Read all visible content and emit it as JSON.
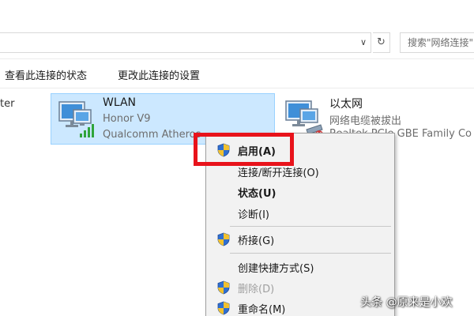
{
  "address_bar": {
    "search_placeholder": "搜索\"网络连接\""
  },
  "command_bar": {
    "items": [
      {
        "label": "查看此连接的状态"
      },
      {
        "label": "更改此连接的设置"
      }
    ]
  },
  "left_panel": {
    "truncated_text": "ter"
  },
  "adapters": [
    {
      "name": "WLAN",
      "status": "Honor V9",
      "device": "Qualcomm Atheros"
    },
    {
      "name": "以太网",
      "status": "网络电缆被拔出",
      "device": "Realtek PCIe GBE Family Co"
    }
  ],
  "context_menu": {
    "items": [
      {
        "label": "启用(A)",
        "icon": "shield-icon"
      },
      {
        "label": "连接/断开连接(O)"
      },
      {
        "label": "状态(U)"
      },
      {
        "label": "诊断(I)"
      },
      {
        "label": "桥接(G)",
        "icon": "shield-icon"
      },
      {
        "label": "创建快捷方式(S)"
      },
      {
        "label": "删除(D)",
        "icon": "shield-icon",
        "disabled": true
      },
      {
        "label": "重命名(M)",
        "icon": "shield-icon"
      }
    ]
  },
  "watermark": "头条 @原来是小欢",
  "colors": {
    "selection_bg": "#cce8ff",
    "selection_border": "#99d1ff",
    "highlight_box": "#e8131b",
    "menu_bg": "#f2f2f2"
  }
}
